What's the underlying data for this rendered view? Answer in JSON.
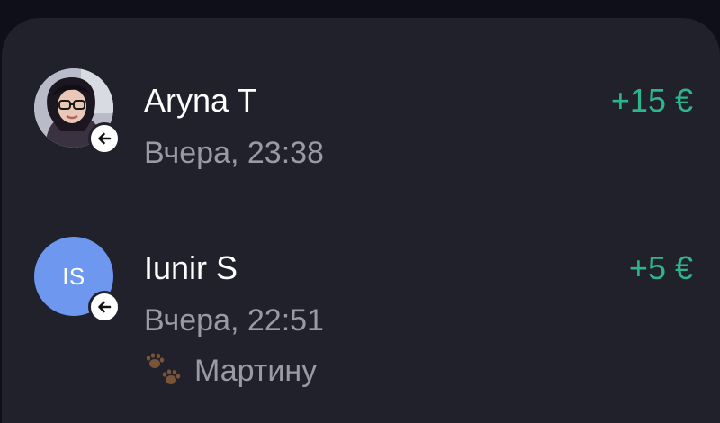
{
  "transactions": [
    {
      "name": "Aryna T",
      "time": "Вчера, 23:38",
      "amount": "+15 €",
      "avatar": "photo",
      "direction_icon": "arrow-left-icon"
    },
    {
      "name": "Iunir S",
      "time": "Вчера, 22:51",
      "amount": "+5 €",
      "avatar_initials": "IS",
      "direction_icon": "arrow-left-icon",
      "note_icon": "paw-prints-icon",
      "note": "Мартину"
    }
  ],
  "colors": {
    "background": "#0f0f19",
    "card": "#21212c",
    "amount_positive": "#2db58c",
    "avatar_initials_bg": "#6e98f0",
    "secondary_text": "#9a9aa5"
  }
}
